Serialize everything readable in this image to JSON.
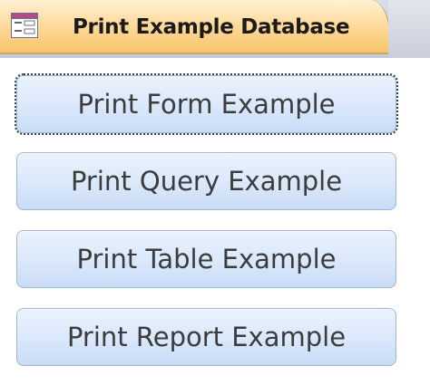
{
  "form_tab": {
    "title": "Print Example Database",
    "icon": "form-icon"
  },
  "buttons": [
    {
      "label": "Print Form Example",
      "focused": true
    },
    {
      "label": "Print Query Example",
      "focused": false
    },
    {
      "label": "Print Table Example",
      "focused": false
    },
    {
      "label": "Print Report Example",
      "focused": false
    }
  ],
  "colors": {
    "tab_accent": "#ffd99a",
    "button_fill": "#dbe9fb",
    "button_border": "#9fb6d6",
    "button_text": "#3c3c3c"
  }
}
